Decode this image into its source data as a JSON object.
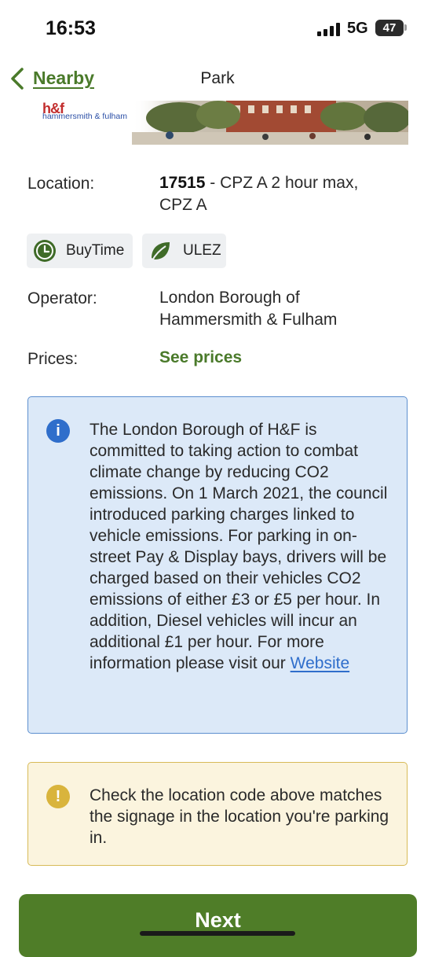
{
  "status_bar": {
    "time": "16:53",
    "network": "5G",
    "battery": "47"
  },
  "nav": {
    "back_label": "Nearby",
    "title": "Park"
  },
  "banner": {
    "logo_mark": "h&f",
    "logo_text": "hammersmith & fulham"
  },
  "details": {
    "location_label": "Location:",
    "location_code": "17515",
    "location_rest": " - CPZ A 2 hour max, CPZ A",
    "chips": [
      {
        "label": "BuyTime",
        "icon": "clock-icon"
      },
      {
        "label": "ULEZ",
        "icon": "leaf-icon"
      }
    ],
    "operator_label": "Operator:",
    "operator_value": "London Borough of Hammersmith & Fulham",
    "prices_label": "Prices:",
    "prices_link": "See prices"
  },
  "info_box": {
    "icon": "info-icon",
    "icon_glyph": "i",
    "text": "The London Borough of H&F is committed to taking action to combat climate change by reducing CO2 emissions. On 1 March 2021, the council introduced parking charges linked to vehicle emissions. For parking in on-street Pay & Display bays, drivers will be charged based on their vehicles CO2 emissions of either £3 or £5 per hour. In addition, Diesel vehicles will incur an additional £1 per hour. For more information please visit our",
    "link": "Website"
  },
  "warning_box": {
    "icon": "warning-icon",
    "icon_glyph": "!",
    "text": "Check the location code above matches the signage in the location you're parking in."
  },
  "next_button": {
    "label": "Next"
  },
  "colors": {
    "brand_green": "#4f7d28",
    "link_green": "#4a7a2a",
    "info_blue": "#2f6ecb",
    "info_bg": "#dce9f8",
    "warning_yellow": "#d9b43c",
    "warning_bg": "#fbf4de"
  }
}
